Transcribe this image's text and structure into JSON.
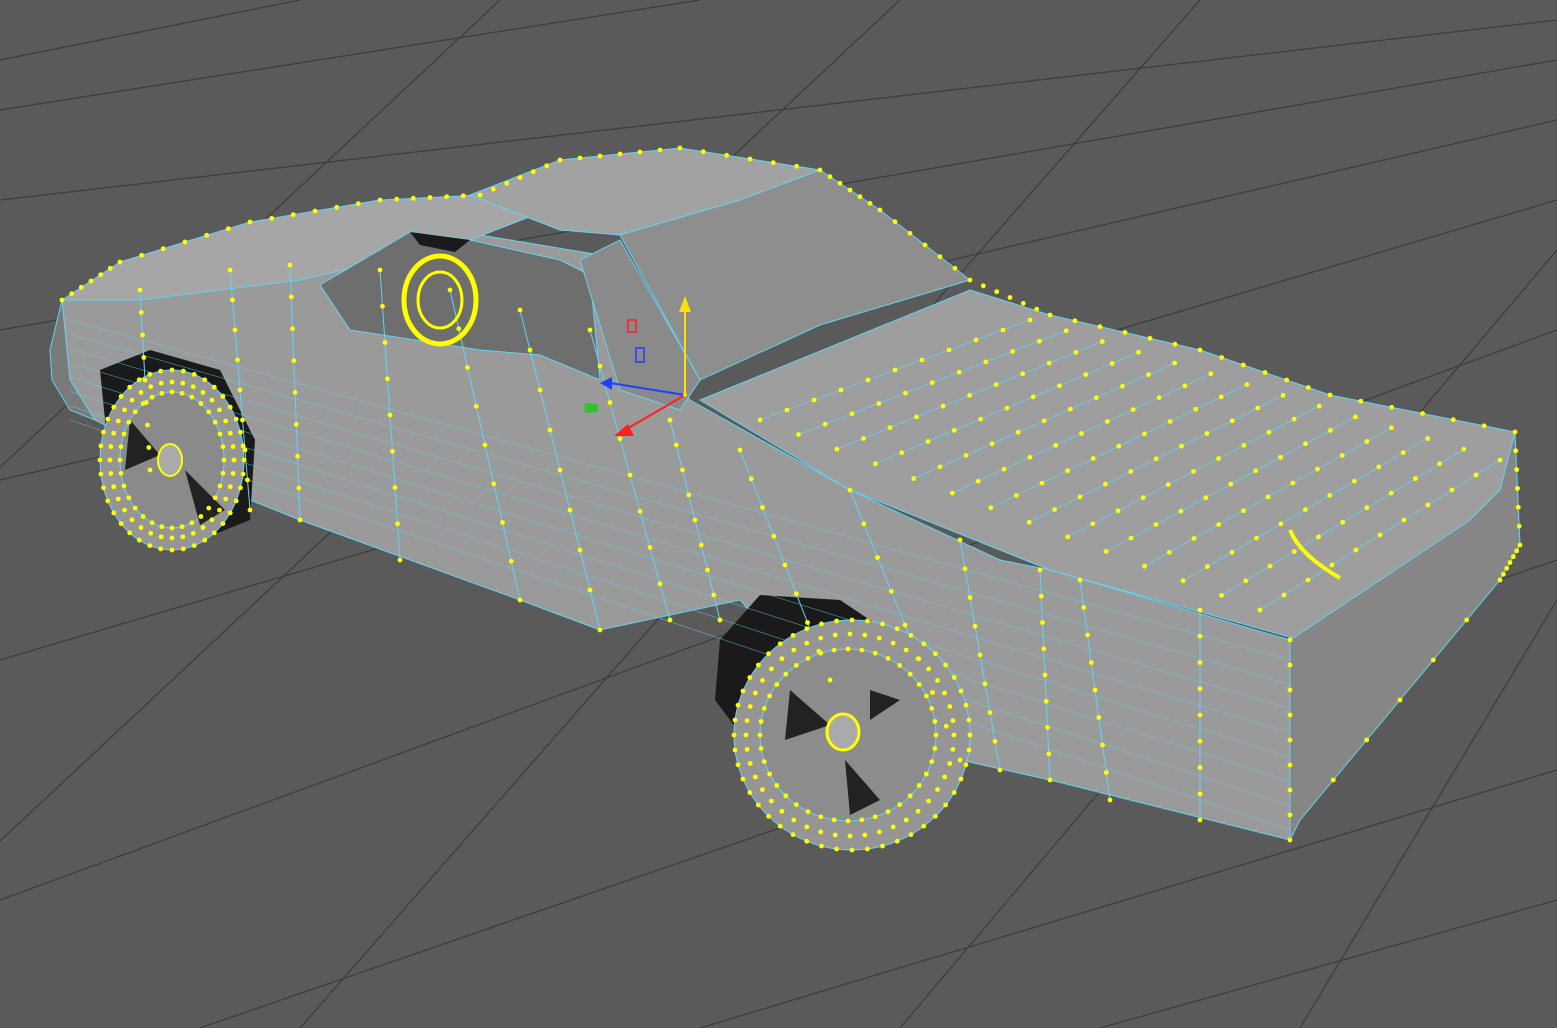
{
  "viewport": {
    "background_color": "#5a5a5a",
    "grid_line_color": "#3c3c3c",
    "mesh_fill_color": "#9a9a9a",
    "mesh_shade_color": "#7d7d7d",
    "mesh_dark_color": "#1a1a1a",
    "wire_color": "#62d3f0",
    "vertex_color": "#ffff00",
    "selection_mode": "vertex",
    "object_selected": true
  },
  "gizmo": {
    "type": "move-manipulator",
    "x_axis_color": "#ff2020",
    "y_axis_color": "#ffe000",
    "z_axis_color": "#2040ff",
    "plane_handle_color": "#30c030"
  }
}
